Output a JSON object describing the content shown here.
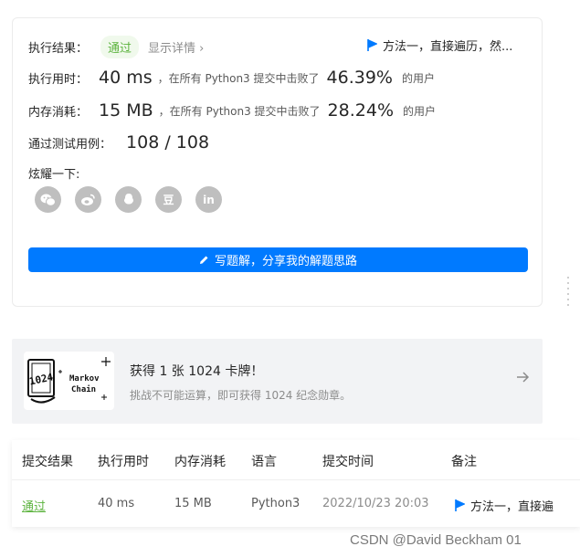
{
  "result": {
    "label": "执行结果：",
    "status": "通过",
    "details_link": "显示详情 ›",
    "solution_link": "方法一，直接遍历，然..."
  },
  "runtime": {
    "label": "执行用时：",
    "value": "40 ms",
    "text": "，在所有 Python3 提交中击败了",
    "percent": "46.39%",
    "suffix": "的用户"
  },
  "memory": {
    "label": "内存消耗：",
    "value": "15 MB",
    "text": "，在所有 Python3 提交中击败了",
    "percent": "28.24%",
    "suffix": "的用户"
  },
  "tests": {
    "label": "通过测试用例：",
    "value": "108 / 108"
  },
  "share": {
    "label": "炫耀一下:",
    "icons": [
      "wechat-icon",
      "weibo-icon",
      "qq-icon",
      "douban-icon",
      "linkedin-icon"
    ],
    "douban_glyph": "豆",
    "linkedin_glyph": "in"
  },
  "write_button": "写题解，分享我的解题思路",
  "promo": {
    "badge_number": "1024",
    "badge_line1": "Markov",
    "badge_line2": "Chain",
    "title": "获得 1 张 1024 卡牌！",
    "subtitle": "挑战不可能运算，即可获得 1024 纪念勋章。"
  },
  "table": {
    "headers": [
      "提交结果",
      "执行用时",
      "内存消耗",
      "语言",
      "提交时间",
      "备注"
    ],
    "row": {
      "result": "通过",
      "runtime": "40 ms",
      "memory": "15 MB",
      "language": "Python3",
      "time": "2022/10/23 20:03",
      "note": "方法一，直接遍"
    }
  },
  "watermark": "CSDN @David Beckham 01",
  "colors": {
    "accent": "#007aff",
    "success": "#5cb33e",
    "success_bg": "#f0f9ec"
  }
}
